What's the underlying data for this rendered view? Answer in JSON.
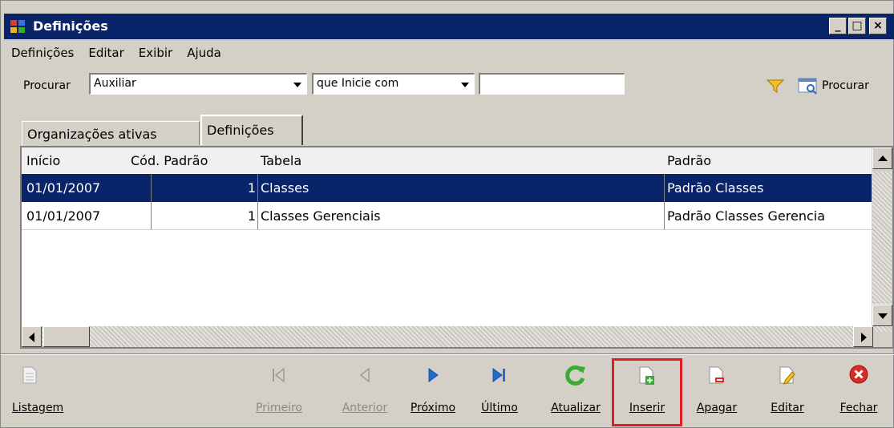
{
  "window": {
    "title": "Definições",
    "controls": {
      "minimize": "_",
      "maximize": "□",
      "close": "×"
    }
  },
  "menu": [
    "Definições",
    "Editar",
    "Exibir",
    "Ajuda"
  ],
  "search": {
    "label": "Procurar",
    "field_value": "Auxiliar",
    "condition_value": "que Inicie com",
    "text_value": "",
    "button_label": "Procurar"
  },
  "tabs": [
    {
      "label": "Organizações ativas",
      "active": false
    },
    {
      "label": "Definições",
      "active": true
    }
  ],
  "table": {
    "columns": [
      "Início",
      "Cód. Padrão",
      "Tabela",
      "Padrão"
    ],
    "rows": [
      {
        "inicio": "01/01/2007",
        "cod": "1",
        "tabela": "Classes",
        "padrao": "Padrão Classes",
        "selected": true
      },
      {
        "inicio": "01/01/2007",
        "cod": "1",
        "tabela": "Classes Gerenciais",
        "padrao": "Padrão Classes Gerencia",
        "selected": false
      }
    ]
  },
  "toolbar": {
    "listagem": "Listagem",
    "primeiro": "Primeiro",
    "anterior": "Anterior",
    "proximo": "Próximo",
    "ultimo": "Último",
    "atualizar": "Atualizar",
    "inserir": "Inserir",
    "apagar": "Apagar",
    "editar": "Editar",
    "fechar": "Fechar"
  },
  "colors": {
    "title_bar": "#0a246a",
    "selection": "#0a246a",
    "highlight": "#e01c24",
    "nav_blue": "#1f6fd1",
    "refresh_green": "#3aaa35",
    "close_red": "#d92c25"
  }
}
